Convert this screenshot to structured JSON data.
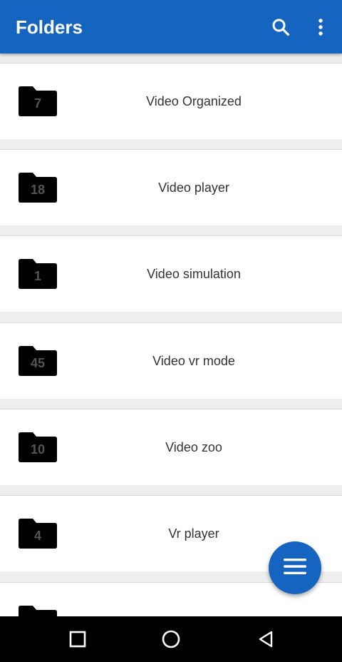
{
  "app_bar": {
    "title": "Folders",
    "background": "#1565c0",
    "search_icon": "search-icon",
    "more_icon": "more-vertical-icon"
  },
  "folders": [
    {
      "count": "7",
      "name": "Video Organized"
    },
    {
      "count": "18",
      "name": "Video player"
    },
    {
      "count": "1",
      "name": "Video simulation"
    },
    {
      "count": "45",
      "name": "Video vr mode"
    },
    {
      "count": "10",
      "name": "Video zoo"
    },
    {
      "count": "4",
      "name": "Vr player"
    },
    {
      "count": "",
      "name": ""
    }
  ],
  "fab": {
    "icon": "menu-icon"
  },
  "nav_bar": {
    "recents_icon": "square-icon",
    "home_icon": "circle-icon",
    "back_icon": "triangle-back-icon"
  }
}
